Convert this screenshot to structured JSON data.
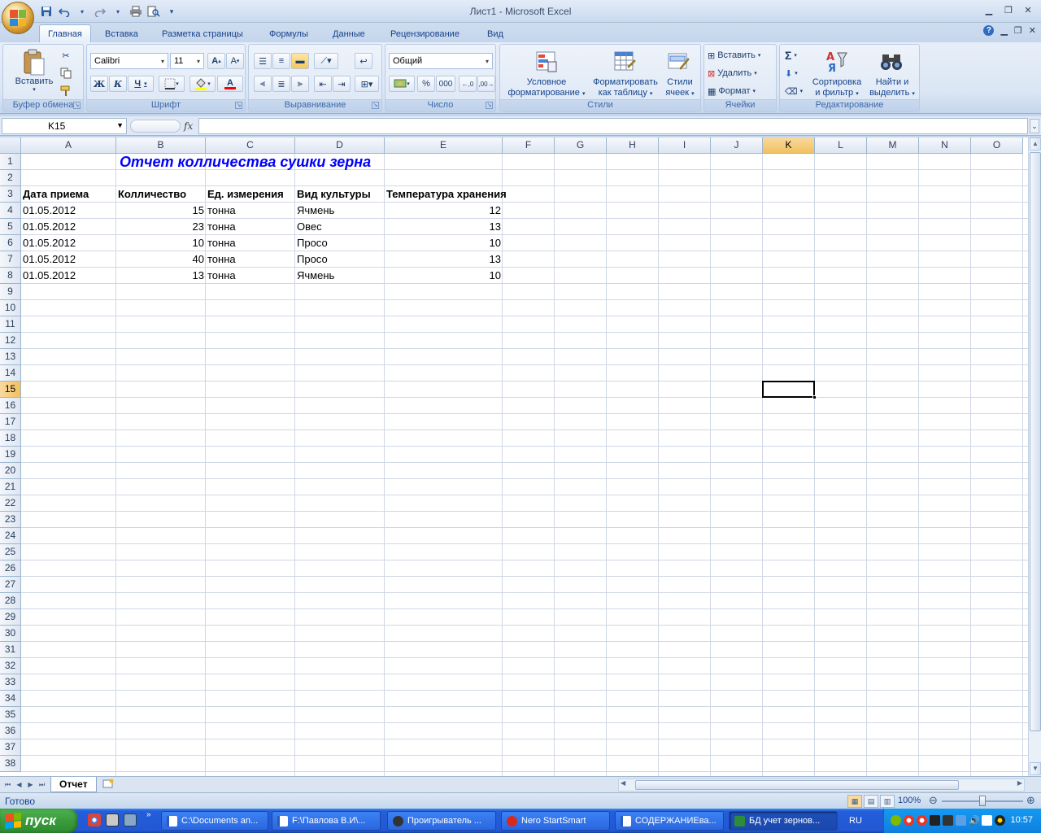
{
  "window": {
    "title": "Лист1 - Microsoft Excel"
  },
  "qat": {
    "save_icon": "save-icon",
    "undo_icon": "undo-icon",
    "redo_icon": "redo-icon",
    "print_icon": "print-icon",
    "preview_icon": "print-preview-icon"
  },
  "tabs": [
    "Главная",
    "Вставка",
    "Разметка страницы",
    "Формулы",
    "Данные",
    "Рецензирование",
    "Вид"
  ],
  "ribbon": {
    "clipboard": {
      "label": "Буфер обмена",
      "paste": "Вставить"
    },
    "font": {
      "label": "Шрифт",
      "name": "Calibri",
      "size": "11",
      "bold": "Ж",
      "italic": "К",
      "underline": "Ч",
      "grow": "A",
      "shrink": "A",
      "color": "A"
    },
    "alignment": {
      "label": "Выравнивание"
    },
    "number": {
      "label": "Число",
      "format": "Общий",
      "percent": "%",
      "thousands": "000"
    },
    "styles": {
      "label": "Стили",
      "cond_line1": "Условное",
      "cond_line2": "форматирование",
      "table_line1": "Форматировать",
      "table_line2": "как таблицу",
      "cell_line1": "Стили",
      "cell_line2": "ячеек"
    },
    "cells": {
      "label": "Ячейки",
      "insert": "Вставить",
      "delete": "Удалить",
      "format": "Формат"
    },
    "editing": {
      "label": "Редактирование",
      "sigma": "Σ",
      "sort_line1": "Сортировка",
      "sort_line2": "и фильтр",
      "find_line1": "Найти и",
      "find_line2": "выделить"
    }
  },
  "formula_bar": {
    "name_box": "K15",
    "fx": "fx",
    "content": ""
  },
  "columns": [
    "A",
    "B",
    "C",
    "D",
    "E",
    "F",
    "G",
    "H",
    "I",
    "J",
    "K",
    "L",
    "M",
    "N",
    "O"
  ],
  "rows": [
    "1",
    "2",
    "3",
    "4",
    "5",
    "6",
    "7",
    "8",
    "9",
    "10",
    "11",
    "12",
    "13",
    "14",
    "15",
    "16",
    "17",
    "18",
    "19",
    "20",
    "21",
    "22",
    "23",
    "24",
    "25",
    "26",
    "27",
    "28",
    "29",
    "30",
    "31",
    "32",
    "33",
    "34",
    "35",
    "36",
    "37",
    "38"
  ],
  "selected": {
    "column": "K",
    "row": "15"
  },
  "sheet": {
    "title": "Отчет колличества сушки зерна",
    "headers": [
      "Дата приема",
      "Колличество",
      "Ед. измерения",
      "Вид культуры",
      "Температура хранения"
    ],
    "records": [
      [
        "01.05.2012",
        "15",
        "тонна",
        "Ячмень",
        "12"
      ],
      [
        "01.05.2012",
        "23",
        "тонна",
        "Овес",
        "13"
      ],
      [
        "01.05.2012",
        "10",
        "тонна",
        "Просо",
        "10"
      ],
      [
        "01.05.2012",
        "40",
        "тонна",
        "Просо",
        "13"
      ],
      [
        "01.05.2012",
        "13",
        "тонна",
        "Ячмень",
        "10"
      ]
    ]
  },
  "sheet_tabs": [
    "Отчет"
  ],
  "status": {
    "ready": "Готово",
    "zoom": "100%"
  },
  "taskbar": {
    "start": "пуск",
    "tasks": [
      "C:\\Documents an...",
      "F:\\Павлова В.И\\...",
      "Проигрыватель ...",
      "Nero StartSmart",
      "СОДЕРЖАНИЕва...",
      "БД учет зернов..."
    ],
    "lang": "RU",
    "clock": "10:57"
  }
}
